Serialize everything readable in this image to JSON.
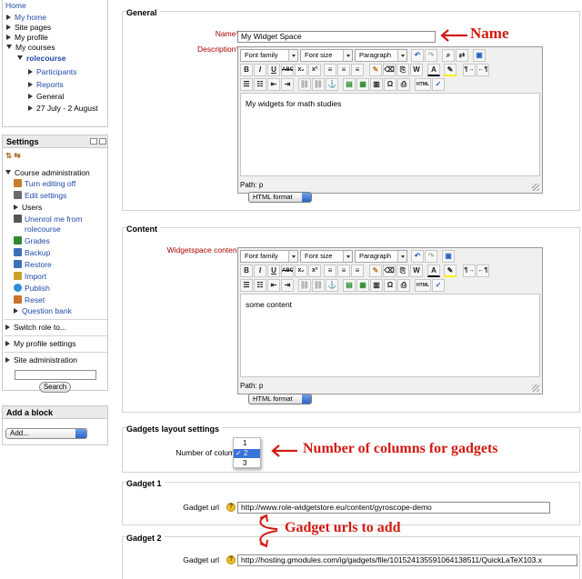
{
  "navigation": {
    "items": [
      {
        "label": "Home",
        "link": true
      },
      {
        "label": "My home",
        "link": true
      },
      {
        "label": "Site pages",
        "link": false
      },
      {
        "label": "My profile",
        "link": false
      },
      {
        "label": "My courses",
        "link": false
      },
      {
        "label": "rolecourse",
        "link": true
      },
      {
        "label": "Participants",
        "link": true
      },
      {
        "label": "Reports",
        "link": true
      },
      {
        "label": "General",
        "link": false
      },
      {
        "label": "27 July - 2 August",
        "link": false
      }
    ]
  },
  "settings": {
    "title": "Settings",
    "course_admin": "Course administration",
    "items": [
      {
        "label": "Turn editing off",
        "icon": "pencil-icon",
        "color": "#c77b2c"
      },
      {
        "label": "Edit settings",
        "icon": "settings-sheet-icon",
        "color": "#6a6a6a"
      },
      {
        "label": "Users",
        "icon": "",
        "color": ""
      },
      {
        "label": "Unenrol me from rolecourse",
        "icon": "unenrol-icon",
        "color": "#555555"
      },
      {
        "label": "Grades",
        "icon": "grades-icon",
        "color": "#2f8a2f"
      },
      {
        "label": "Backup",
        "icon": "backup-icon",
        "color": "#3d6fb8"
      },
      {
        "label": "Restore",
        "icon": "restore-icon",
        "color": "#3d6fb8"
      },
      {
        "label": "Import",
        "icon": "import-icon",
        "color": "#c9a227"
      },
      {
        "label": "Publish",
        "icon": "publish-icon",
        "color": "#2a8fd6"
      },
      {
        "label": "Reset",
        "icon": "reset-icon",
        "color": "#c9732c"
      },
      {
        "label": "Question bank",
        "icon": "",
        "color": ""
      }
    ],
    "switch_role": "Switch role to...",
    "profile_settings": "My profile settings",
    "site_admin": "Site administration",
    "search_button": "Search"
  },
  "add_block": {
    "title": "Add a block",
    "select_value": "Add..."
  },
  "general": {
    "legend": "General",
    "name_label": "Name",
    "name_value": "My Widget Space",
    "description_label": "Description",
    "description_text": "My widgets for math studies",
    "path": "Path: p",
    "format": "HTML format"
  },
  "editor_toolbar": {
    "font_family": "Font family",
    "font_size": "Font size",
    "paragraph": "Paragraph"
  },
  "content": {
    "legend": "Content",
    "label": "Widgetspace content",
    "text": "some content",
    "path": "Path: p",
    "format": "HTML format"
  },
  "layout": {
    "legend": "Gadgets layout settings",
    "columns_label": "Number of columns",
    "options": [
      "1",
      "2",
      "3"
    ],
    "selected": "2"
  },
  "gadget1": {
    "legend": "Gadget 1",
    "url_label": "Gadget url",
    "url_value": "http://www.role-widgetstore.eu/content/gyroscope-demo"
  },
  "gadget2": {
    "legend": "Gadget 2",
    "url_label": "Gadget url",
    "url_value": "http://hosting.gmodules.com/ig/gadgets/file/101524135591064138511/QuickLaTeX103.x"
  },
  "annotations": {
    "name": "Name",
    "columns": "Number of columns for gadgets",
    "urls": "Gadget urls to add",
    "color": "#d11a10"
  }
}
